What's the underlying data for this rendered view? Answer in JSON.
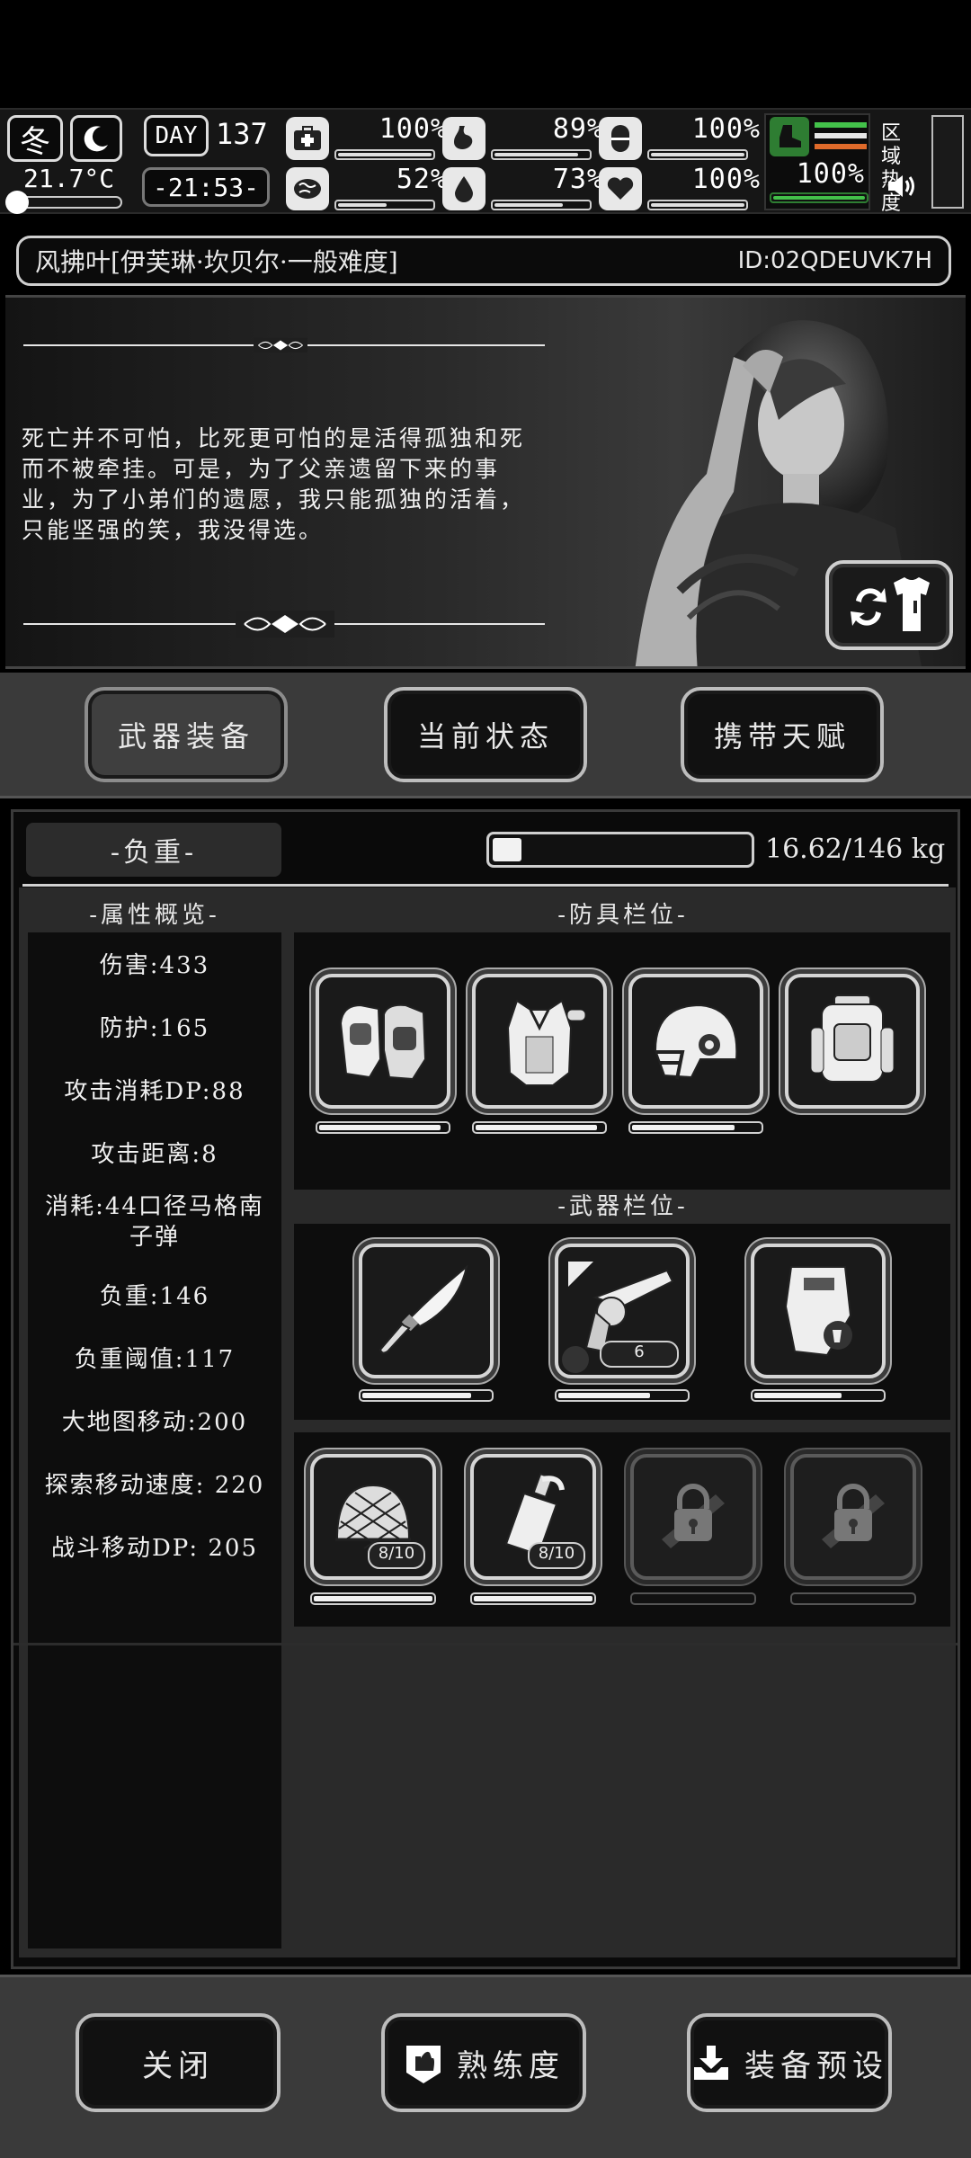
{
  "hud": {
    "season": "冬",
    "temperature": "21.7°C",
    "day_label": "DAY",
    "day_number": "137",
    "clock": "-21:53-",
    "stats": [
      {
        "icon": "medkit-icon",
        "value": "100%",
        "fill": 1.0
      },
      {
        "icon": "stomach-icon",
        "value": "89%",
        "fill": 0.89
      },
      {
        "icon": "capsule-icon",
        "value": "100%",
        "fill": 1.0
      },
      {
        "icon": "brain-icon",
        "value": "52%",
        "fill": 0.52
      },
      {
        "icon": "water-drop-icon",
        "value": "73%",
        "fill": 0.73
      },
      {
        "icon": "heart-icon",
        "value": "100%",
        "fill": 1.0
      }
    ],
    "stamina_value": "100%",
    "stamina_fill": 1.0,
    "region_heat_label": "区域热度"
  },
  "character": {
    "name": "风拂叶[伊芙琳·坎贝尔·一般难度]",
    "id": "ID:02QDEUVK7H",
    "bio": "死亡并不可怕，比死更可怕的是活得孤独和死而不被牵挂。可是，为了父亲遗留下来的事业，为了小弟们的遗愿，我只能孤独的活着，只能坚强的笑，我没得选。"
  },
  "tabs": [
    {
      "label": "武器装备",
      "active": true
    },
    {
      "label": "当前状态",
      "active": false
    },
    {
      "label": "携带天赋",
      "active": false
    }
  ],
  "load": {
    "label": "-负重-",
    "value": "16.62/146 kg",
    "fill": 0.114
  },
  "attributes": {
    "title": "-属性概览-",
    "items": [
      "伤害:433",
      "防护:165",
      "攻击消耗DP:88",
      "攻击距离:8",
      "消耗:44口径马格南子弹",
      "负重:146",
      "负重阈值:117",
      "大地图移动:200",
      "探索移动速度: 220",
      "战斗移动DP: 205"
    ]
  },
  "armor": {
    "title": "-防具栏位-",
    "slots": [
      {
        "icon": "gauntlets-icon",
        "fill": 0.95
      },
      {
        "icon": "body-armor-icon",
        "fill": 0.95
      },
      {
        "icon": "helmet-icon",
        "fill": 0.8
      },
      {
        "icon": "backpack-icon",
        "fill": 0
      }
    ]
  },
  "weapons": {
    "title": "-武器栏位-",
    "slots": [
      {
        "icon": "knife-icon",
        "fill": 0.85,
        "badge": ""
      },
      {
        "icon": "revolver-icon",
        "fill": 0.72,
        "badge": "6"
      },
      {
        "icon": "riot-shield-icon",
        "fill": 0.68,
        "badge": ""
      }
    ]
  },
  "items": {
    "slots": [
      {
        "icon": "net-icon",
        "badge": "8/10",
        "fill": 1.0,
        "locked": false
      },
      {
        "icon": "bottle-icon",
        "badge": "8/10",
        "fill": 1.0,
        "locked": false
      },
      {
        "icon": "lock-icon",
        "badge": "",
        "fill": 0,
        "locked": true
      },
      {
        "icon": "lock-icon",
        "badge": "",
        "fill": 0,
        "locked": true
      }
    ]
  },
  "bottom": {
    "close_label": "关闭",
    "proficiency_label": "熟练度",
    "preset_label": "装备预设"
  }
}
